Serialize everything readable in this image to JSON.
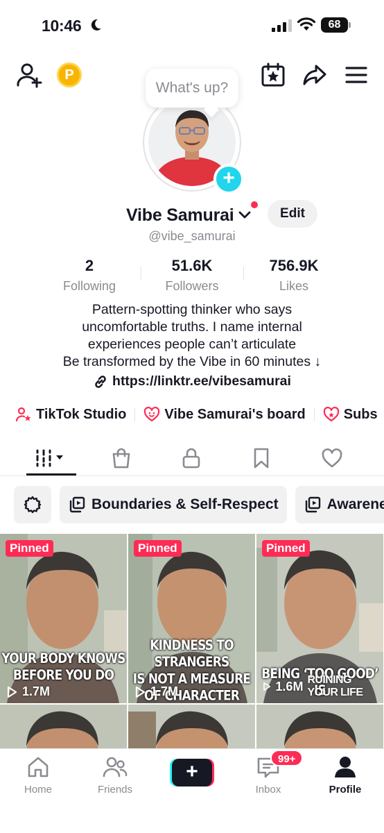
{
  "status_bar": {
    "time": "10:46",
    "battery": "68"
  },
  "bubble": {
    "text": "What's up?"
  },
  "profile": {
    "display_name": "Vibe Samurai",
    "username": "@vibe_samurai",
    "edit_label": "Edit",
    "stats": [
      {
        "value": "2",
        "label": "Following"
      },
      {
        "value": "51.6K",
        "label": "Followers"
      },
      {
        "value": "756.9K",
        "label": "Likes"
      }
    ],
    "bio_lines": [
      "Pattern-spotting thinker who says",
      "uncomfortable truths. I name internal",
      "experiences people can’t articulate",
      "Be transformed by the Vibe in 60 minutes ↓"
    ],
    "link": "https://linktr.ee/vibesamurai"
  },
  "shortcuts": [
    {
      "label": "TikTok Studio"
    },
    {
      "label": "Vibe Samurai's board"
    },
    {
      "label": "Subs"
    }
  ],
  "collections": [
    {
      "label": "Boundaries & Self-Respect"
    },
    {
      "label": "Awarene"
    }
  ],
  "videos": [
    {
      "pinned": "Pinned",
      "caption_lines": [
        "YOUR BODY KNOWS",
        "BEFORE YOU DO"
      ],
      "views": "1.7M"
    },
    {
      "pinned": "Pinned",
      "caption_lines": [
        "KINDNESS TO STRANGERS",
        "IS NOT A MEASURE",
        "OF CHARACTER"
      ],
      "views": "1.7M"
    },
    {
      "pinned": "Pinned",
      "caption_lines": [
        "BEING ‘TOO GOOD’ IS",
        "RUINING YOUR LIFE"
      ],
      "views": "1.6M"
    }
  ],
  "bottom_nav": {
    "home": "Home",
    "friends": "Friends",
    "inbox": "Inbox",
    "inbox_badge": "99+",
    "profile": "Profile"
  },
  "colors": {
    "accent_red": "#fe2c55",
    "accent_cyan": "#20d5ec",
    "text_primary": "#161823",
    "text_secondary": "#8a8b91"
  }
}
